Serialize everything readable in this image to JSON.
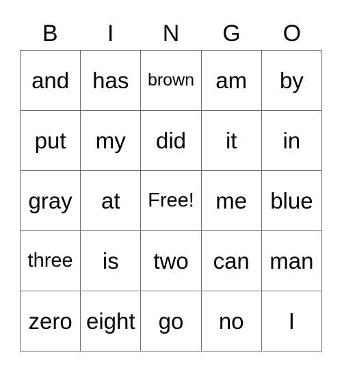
{
  "title_letters": [
    "B",
    "I",
    "N",
    "G",
    "O"
  ],
  "grid": [
    [
      "and",
      "has",
      "brown",
      "am",
      "by"
    ],
    [
      "put",
      "my",
      "did",
      "it",
      "in"
    ],
    [
      "gray",
      "at",
      "Free!",
      "me",
      "blue"
    ],
    [
      "three",
      "is",
      "two",
      "can",
      "man"
    ],
    [
      "zero",
      "eight",
      "go",
      "no",
      "I"
    ]
  ]
}
